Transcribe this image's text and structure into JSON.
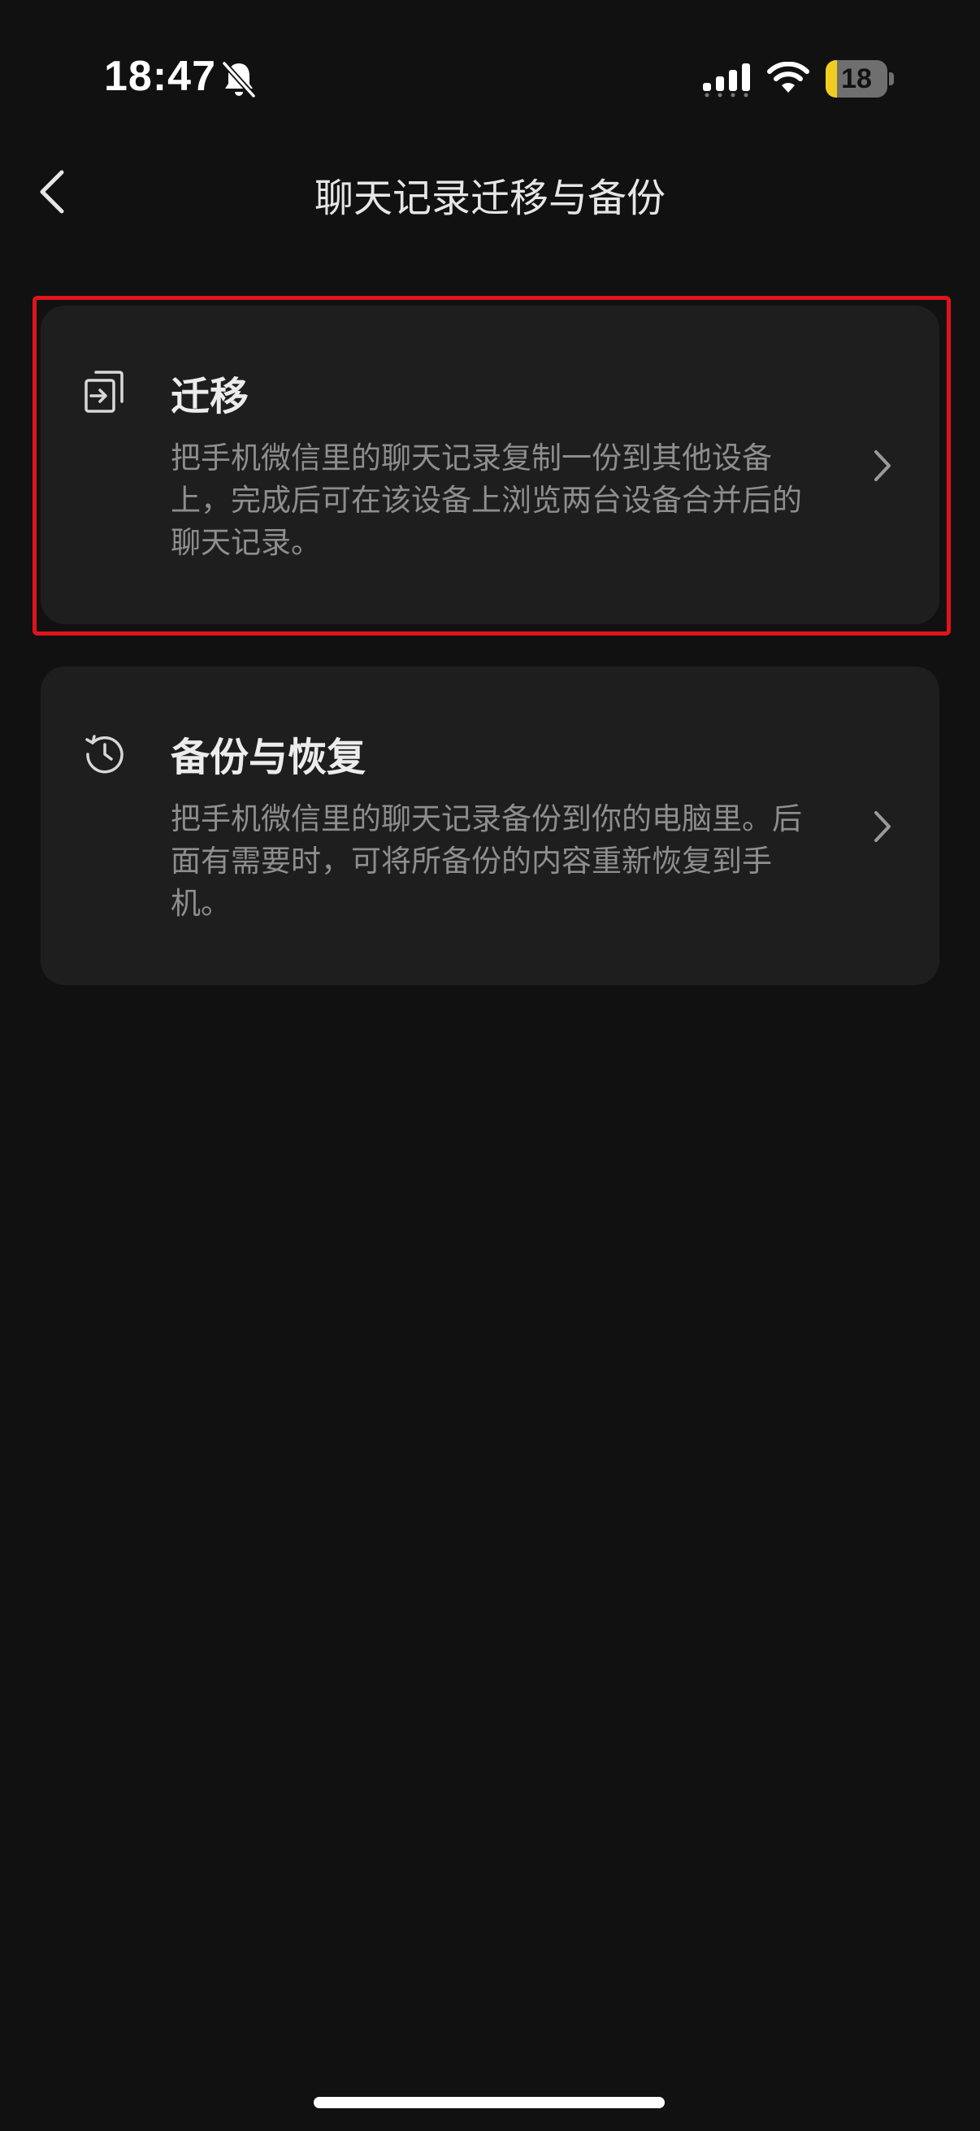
{
  "status_bar": {
    "time": "18:47",
    "battery_level": "18",
    "battery_fraction": 0.18,
    "bell_icon": "bell-slash-icon",
    "signal_icon": "cellular-signal-icon",
    "wifi_icon": "wifi-icon"
  },
  "nav": {
    "back_icon": "chevron-left-icon",
    "title": "聊天记录迁移与备份"
  },
  "options": [
    {
      "icon": "migrate-icon",
      "title": "迁移",
      "description": "把手机微信里的聊天记录复制一份到其他设备上，完成后可在该设备上浏览两台设备合并后的聊天记录。",
      "chevron_icon": "chevron-right-icon"
    },
    {
      "icon": "history-icon",
      "title": "备份与恢复",
      "description": "把手机微信里的聊天记录备份到你的电脑里。后面有需要时，可将所备份的内容重新恢复到手机。",
      "chevron_icon": "chevron-right-icon"
    }
  ],
  "colors": {
    "background": "#111111",
    "card": "#1e1e1e",
    "highlight": "#e0141b",
    "battery": "#f3cc20"
  }
}
